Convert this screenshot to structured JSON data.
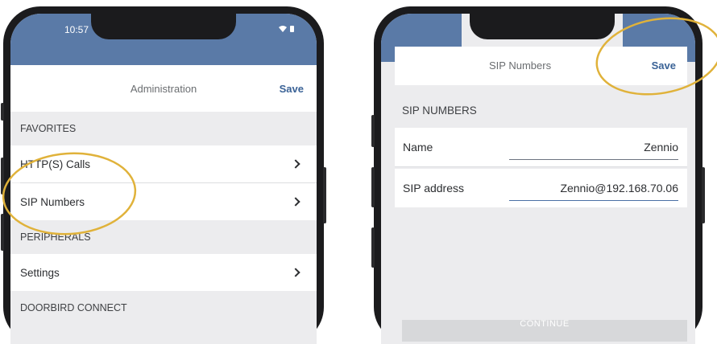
{
  "left_screen": {
    "status_bar": {
      "time": "10:57"
    },
    "nav": {
      "title": "Administration",
      "save_label": "Save"
    },
    "sections": {
      "favorites": "FAVORITES",
      "peripherals": "PERIPHERALS",
      "doorbird_connect": "DOORBIRD CONNECT"
    },
    "rows": {
      "http_calls": "HTTP(S) Calls",
      "sip_numbers": "SIP Numbers",
      "settings": "Settings"
    }
  },
  "right_screen": {
    "nav": {
      "title": "SIP Numbers",
      "save_label": "Save"
    },
    "section": "SIP NUMBERS",
    "fields": {
      "name_label": "Name",
      "name_value": "Zennio",
      "sip_label": "SIP address",
      "sip_value": "Zennio@192.168.70.06"
    },
    "continue_label": "CONTINUE"
  },
  "colors": {
    "header_blue": "#5a7aa7",
    "save_blue": "#3a6296",
    "annotation_gold": "#e0b23a",
    "list_background": "#ececee"
  },
  "icons": [
    "chevron-right-icon",
    "wifi-icon",
    "battery-icon"
  ]
}
